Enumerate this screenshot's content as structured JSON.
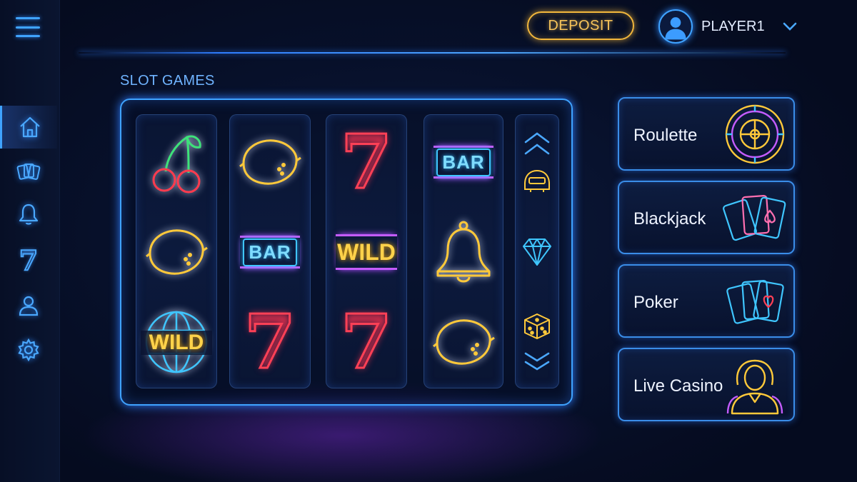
{
  "header": {
    "deposit_label": "DEPOSIT",
    "username": "PLAYER1",
    "menu_icon": "hamburger-menu-icon",
    "user_icon": "user-avatar-icon",
    "dropdown_icon": "chevron-down-icon"
  },
  "sidebar": {
    "items": [
      {
        "icon": "home-icon",
        "active": true
      },
      {
        "icon": "cards-icon",
        "active": false
      },
      {
        "icon": "bell-icon",
        "active": false
      },
      {
        "icon": "seven-icon",
        "glyph": "7",
        "active": false
      },
      {
        "icon": "user-icon",
        "active": false
      },
      {
        "icon": "settings-icon",
        "active": false
      }
    ]
  },
  "slots": {
    "title": "SLOT GAMES",
    "reels": [
      [
        "cherry",
        "lemon",
        "wild-globe"
      ],
      [
        "lemon",
        "bar",
        "seven"
      ],
      [
        "seven",
        "wild",
        "seven"
      ],
      [
        "bar",
        "bell",
        "lemon"
      ]
    ],
    "symbol_text": {
      "seven": "7",
      "bar": "BAR",
      "wild": "WILD"
    },
    "side_reel": [
      "chevron-up-icon",
      "slot-machine-icon",
      "diamond-icon",
      "dice-icon",
      "chevron-down-icon"
    ]
  },
  "games": [
    {
      "label": "Roulette",
      "icon": "roulette-wheel-icon"
    },
    {
      "label": "Blackjack",
      "icon": "playing-cards-icon"
    },
    {
      "label": "Poker",
      "icon": "poker-cards-icon"
    },
    {
      "label": "Live Casino",
      "icon": "dealer-icon"
    }
  ],
  "colors": {
    "accent_blue": "#3fa3ff",
    "gold": "#f2b73c",
    "neon_red": "#ff4056",
    "neon_purple": "#c45cff",
    "neon_cyan": "#3fc6ff",
    "neon_yellow": "#ffd24a",
    "background": "#07102a"
  }
}
